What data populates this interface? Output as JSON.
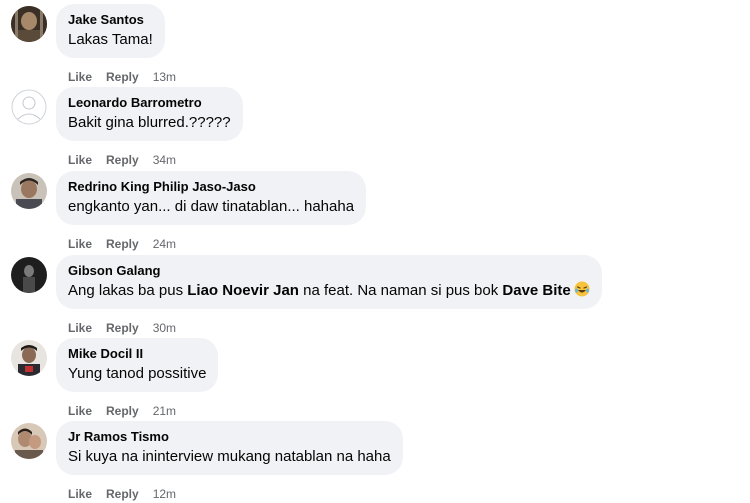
{
  "comments": [
    {
      "author": "Jake Santos",
      "text": "Lakas Tama!",
      "like_label": "Like",
      "reply_label": "Reply",
      "time": "13m",
      "avatar": "profile-photo-icon"
    },
    {
      "author": "Leonardo Barrometro",
      "text": "Bakit gina blurred.?????",
      "like_label": "Like",
      "reply_label": "Reply",
      "time": "34m",
      "avatar": "default-avatar-icon"
    },
    {
      "author": "Redrino King Philip Jaso-Jaso",
      "text": "engkanto yan... di daw tinatablan... hahaha",
      "like_label": "Like",
      "reply_label": "Reply",
      "time": "24m",
      "avatar": "profile-photo-icon"
    },
    {
      "author": "Gibson Galang",
      "text_before": "Ang lakas ba pus ",
      "mention1": "Liao Noevir Jan",
      "text_middle": " na feat. Na naman si pus bok ",
      "mention2": "Dave Bite",
      "emoji": "laughing-emoji-icon",
      "like_label": "Like",
      "reply_label": "Reply",
      "time": "30m",
      "avatar": "profile-photo-icon"
    },
    {
      "author": "Mike Docil II",
      "text": "Yung tanod possitive",
      "like_label": "Like",
      "reply_label": "Reply",
      "time": "21m",
      "avatar": "profile-photo-icon"
    },
    {
      "author": "Jr Ramos Tismo",
      "text": "Si kuya na ininterview mukang natablan na haha",
      "like_label": "Like",
      "reply_label": "Reply",
      "time": "12m",
      "avatar": "profile-photo-icon"
    }
  ],
  "colors": {
    "bubble": "#f0f2f5",
    "text": "#050505",
    "meta": "#65676b"
  }
}
